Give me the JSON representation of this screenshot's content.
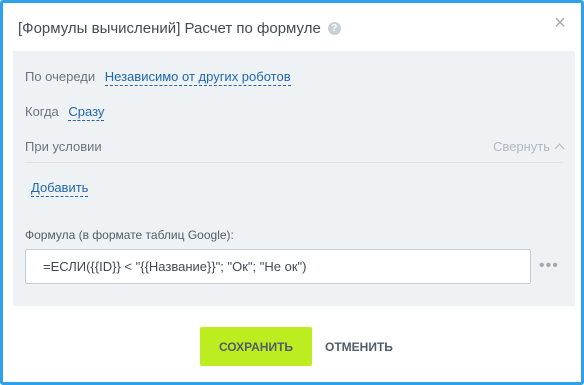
{
  "dialog": {
    "title": "[Формулы вычислений] Расчет по формуле",
    "help_icon": "?",
    "close_icon": "×"
  },
  "settings": {
    "queue_label": "По очереди",
    "queue_value": "Независимо от других роботов",
    "when_label": "Когда",
    "when_value": "Сразу",
    "condition_label": "При условии",
    "collapse_label": "Свернуть",
    "add_label": "Добавить"
  },
  "formula": {
    "label": "Формула (в формате таблиц Google):",
    "value": "=ЕСЛИ({{ID}} < \"{{Название}}\"; \"Ок\"; \"Не ок\")",
    "more_icon": "•••"
  },
  "buttons": {
    "save": "СОХРАНИТЬ",
    "cancel": "ОТМЕНИТЬ"
  },
  "colors": {
    "border": "#2fa0ec",
    "panel_bg": "#eef2f4",
    "link": "#2067b0",
    "save_bg": "#bbed21"
  }
}
